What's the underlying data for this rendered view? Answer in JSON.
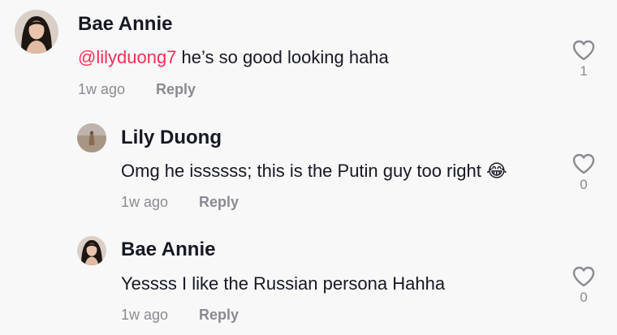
{
  "comments": [
    {
      "author": "Bae Annie",
      "mention": "@lilyduong7",
      "text": " he’s so good looking haha",
      "time": "1w ago",
      "reply_label": "Reply",
      "likes": "1",
      "avatar": "woman-portrait-avatar"
    },
    {
      "author": "Lily Duong",
      "text": "Omg he issssss; this is the Putin guy too right",
      "emoji": "😂",
      "time": "1w ago",
      "reply_label": "Reply",
      "likes": "0",
      "avatar": "beach-figure-avatar"
    },
    {
      "author": "Bae Annie",
      "text": "Yessss I like the Russian persona Hahha",
      "time": "1w ago",
      "reply_label": "Reply",
      "likes": "0",
      "avatar": "woman-portrait-avatar"
    }
  ],
  "icons": {
    "like": "heart-outline-icon"
  },
  "colors": {
    "background": "#f8f8f8",
    "mention": "#fe2c55",
    "secondary_text": "#8a8b91",
    "primary_text": "#161823"
  }
}
